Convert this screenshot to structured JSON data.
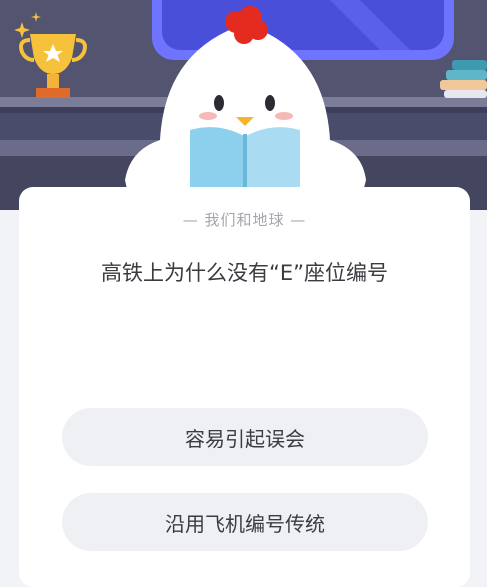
{
  "quiz": {
    "category": "— 我们和地球 —",
    "question": "高铁上为什么没有“E”座位编号",
    "options": [
      {
        "label": "容易引起误会"
      },
      {
        "label": "沿用飞机编号传统"
      }
    ]
  },
  "colors": {
    "header_bg": "#4a4c6b",
    "card_bg": "#ffffff",
    "option_bg": "#eef0f3",
    "mascot_comb": "#e42b1f"
  },
  "icons": [
    "trophy-icon",
    "sparkle-icon",
    "books-icon",
    "mascot-chick-icon"
  ]
}
